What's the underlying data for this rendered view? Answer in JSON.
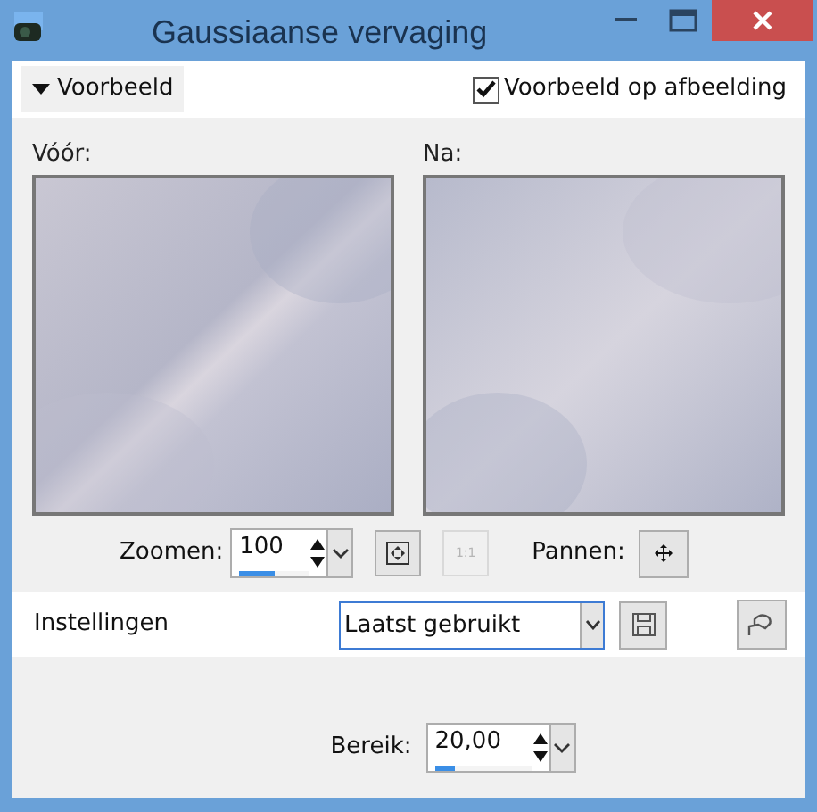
{
  "window": {
    "title": "Gaussiaanse vervaging"
  },
  "preview_toggle": {
    "label": "Voorbeeld",
    "expanded": true
  },
  "preview_on_image": {
    "label": "Voorbeeld op afbeelding",
    "checked": true
  },
  "previews": [
    {
      "label": "Vóór:",
      "kind": "before"
    },
    {
      "label": "Na:",
      "kind": "after"
    }
  ],
  "zoom": {
    "label": "Zoomen:",
    "value": "100",
    "level": 0.5
  },
  "actual_size_button": {
    "label": "1:1",
    "disabled": true
  },
  "pan": {
    "label": "Pannen:"
  },
  "settings": {
    "label": "Instellingen",
    "value": "Laatst gebruikt"
  },
  "range": {
    "label": "Bereik:",
    "value": "20,00",
    "level": 0.2
  }
}
